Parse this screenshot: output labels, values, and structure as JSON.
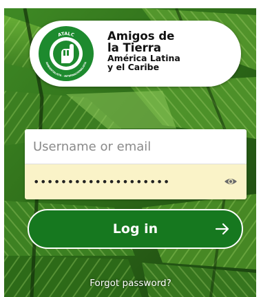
{
  "logo": {
    "seal_top": "ATALC",
    "seal_bottom": "AMBIENTALISTA · INTERNACIONALISTA",
    "line1": "Amigos de",
    "line2": "la Tierra",
    "line3": "América Latina",
    "line4": "y el Caribe"
  },
  "form": {
    "username_placeholder": "Username or email",
    "username_value": "",
    "password_value": "passwordpasswordpass"
  },
  "actions": {
    "login_label": "Log in",
    "forgot_label": "Forgot password?"
  },
  "icons": {
    "reveal_password": "eye-icon",
    "submit": "arrow-right-icon",
    "seal": "raised-fist-icon"
  },
  "colors": {
    "brand_green": "#16781f",
    "autofill_yellow": "#faf3c8",
    "background_leaf": "#2f6b1c"
  }
}
